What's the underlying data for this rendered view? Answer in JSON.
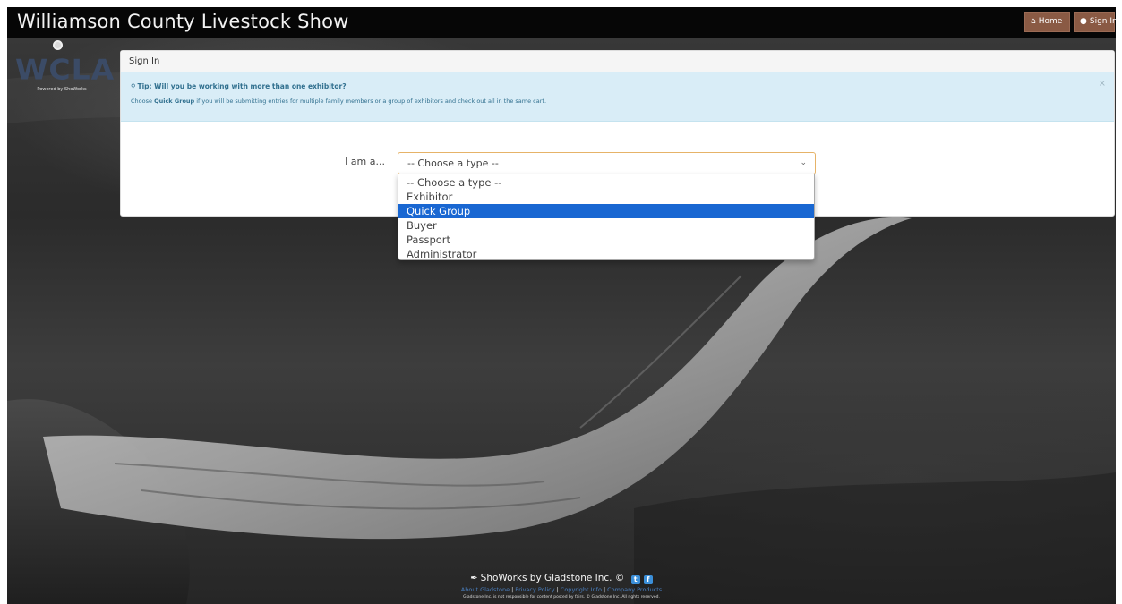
{
  "navbar": {
    "brand": "Williamson County Livestock Show",
    "home_label": "Home",
    "home_icon": "home-icon",
    "signin_label": "Sign In",
    "signin_icon": "user-icon",
    "button_color": "#8a5a44"
  },
  "logo": {
    "mark": "WCLA",
    "powered_by": "Powered by ShoWorks"
  },
  "panel": {
    "heading": "Sign In",
    "tip": {
      "title": "Tip: Will you be working with more than one exhibitor?",
      "body_prefix": "Choose ",
      "body_bold": "Quick Group",
      "body_suffix": " if you will be submitting entries for multiple family members or a group of exhibitors and check out all in the same cart.",
      "close": "×"
    },
    "form": {
      "label": "I am a...",
      "selected_value": "-- Choose a type --"
    }
  },
  "dropdown": {
    "options": [
      "-- Choose a type --",
      "Exhibitor",
      "Quick Group",
      "Buyer",
      "Passport",
      "Administrator"
    ],
    "highlighted_index": 2,
    "highlight_color": "#1967d2"
  },
  "footer": {
    "main": "ShoWorks by Gladstone Inc. ©",
    "links": [
      "About Gladstone",
      "Privacy Policy",
      "Copyright Info",
      "Company Products"
    ],
    "disclaimer": "Gladstone Inc. is not responsible for content posted by fairs. © Gladstone Inc. All rights reserved."
  }
}
